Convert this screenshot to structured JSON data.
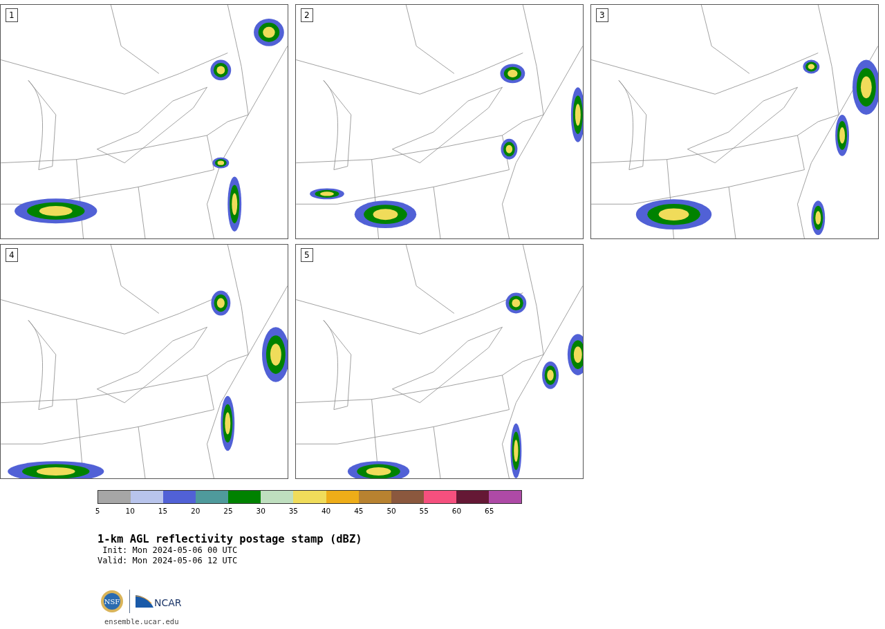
{
  "panels": [
    {
      "member": "1"
    },
    {
      "member": "2"
    },
    {
      "member": "3"
    },
    {
      "member": "4"
    },
    {
      "member": "5"
    }
  ],
  "colorbar": {
    "bins": [
      {
        "color": "#a6a6a6"
      },
      {
        "color": "#b8c4ec"
      },
      {
        "color": "#5161d6"
      },
      {
        "color": "#4f9a9c"
      },
      {
        "color": "#008200"
      },
      {
        "color": "#bfdfbf"
      },
      {
        "color": "#f0dc5a"
      },
      {
        "color": "#eead18"
      },
      {
        "color": "#b88230"
      },
      {
        "color": "#8b583e"
      },
      {
        "color": "#f5507e"
      },
      {
        "color": "#651835"
      },
      {
        "color": "#ae4aa6"
      }
    ],
    "ticks": [
      "5",
      "10",
      "15",
      "20",
      "25",
      "30",
      "35",
      "40",
      "45",
      "50",
      "55",
      "60",
      "65"
    ]
  },
  "title": "1-km AGL reflectivity postage stamp (dBZ)",
  "init": " Init: Mon 2024-05-06 00 UTC",
  "valid": "Valid: Mon 2024-05-06 12 UTC",
  "logos": {
    "nsf": "NSF",
    "ncar": "NCAR"
  },
  "site": "ensemble.ucar.edu"
}
